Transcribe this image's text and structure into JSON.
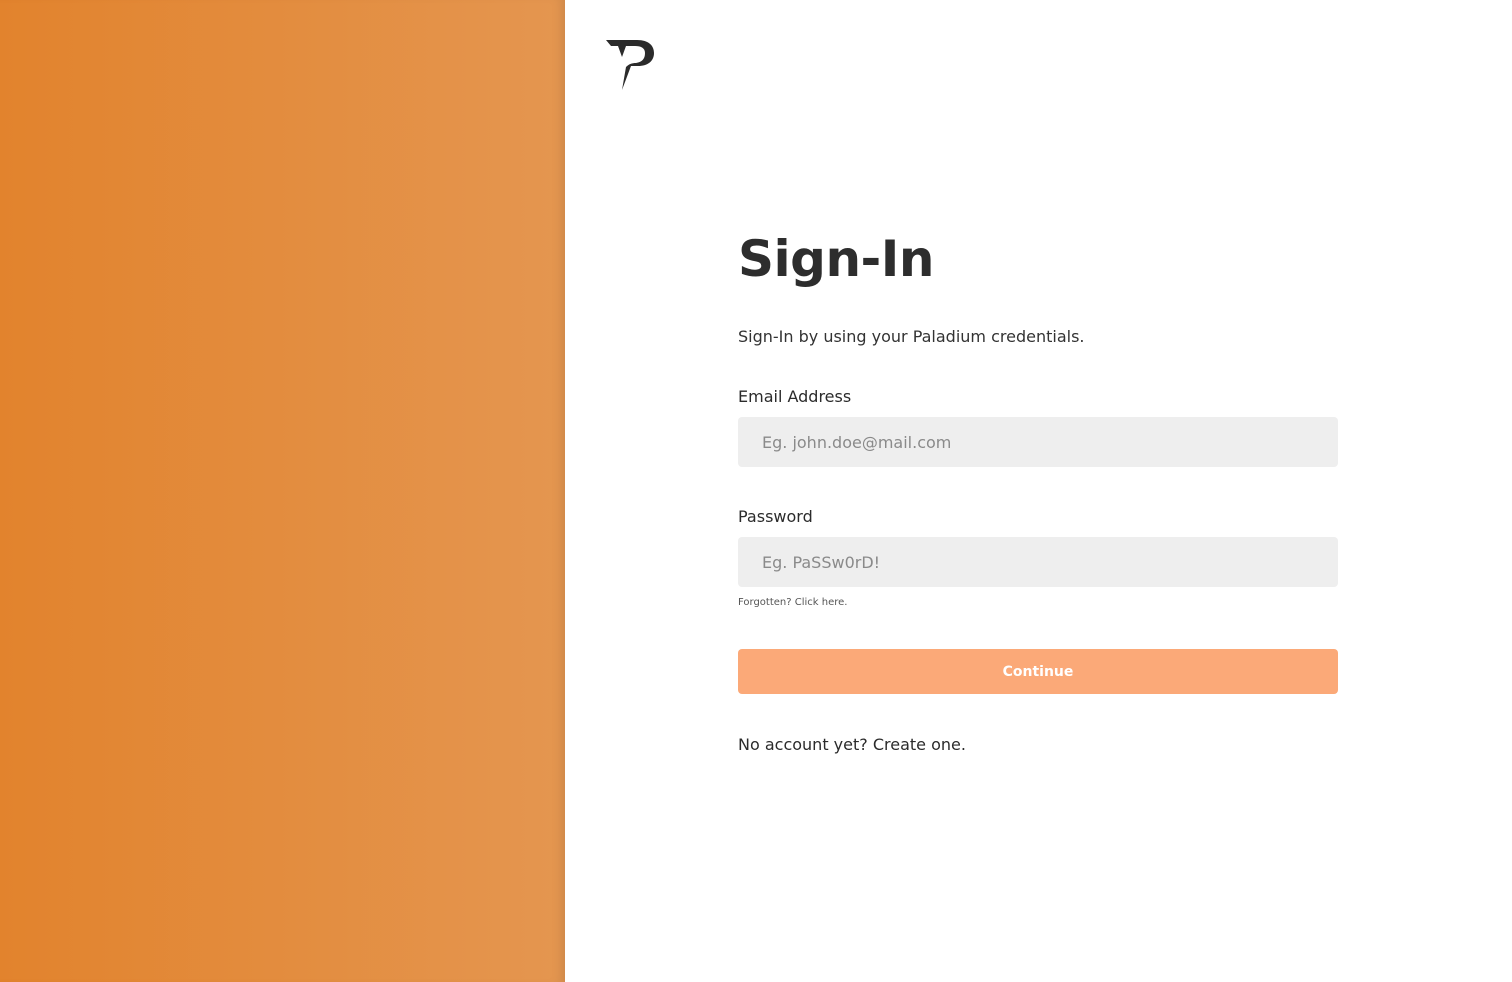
{
  "brand": {
    "logo_icon": "paladium-p-logo",
    "accent_color": "#e2832d",
    "button_color": "#fba978"
  },
  "signin": {
    "title": "Sign-In",
    "subtitle": "Sign-In by using your Paladium credentials.",
    "email": {
      "label": "Email Address",
      "placeholder": "Eg. john.doe@mail.com",
      "value": ""
    },
    "password": {
      "label": "Password",
      "placeholder": "Eg. PaSSw0rD!",
      "value": ""
    },
    "forgot_link": "Forgotten? Click here.",
    "continue_label": "Continue",
    "signup_link": "No account yet? Create one."
  }
}
